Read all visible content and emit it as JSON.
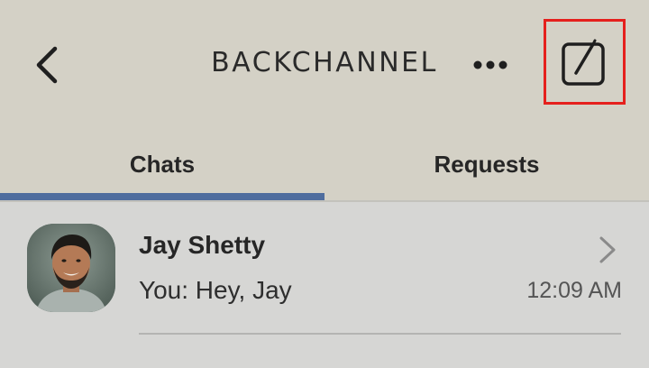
{
  "header": {
    "title": "BACKCHANNEL",
    "back_icon": "chevron-left-icon",
    "more_icon": "more-horizontal-icon",
    "compose_icon": "compose-icon",
    "background_color": "#d4d1c6",
    "highlight_color": "#e5201d"
  },
  "tabs": [
    {
      "label": "Chats",
      "selected": true
    },
    {
      "label": "Requests",
      "selected": false
    }
  ],
  "tab_indicator_color": "#4f6d9e",
  "chats": [
    {
      "name": "Jay Shetty",
      "last_message": "You: Hey, Jay",
      "time": "12:09 AM",
      "chevron_icon": "chevron-right-icon"
    }
  ]
}
